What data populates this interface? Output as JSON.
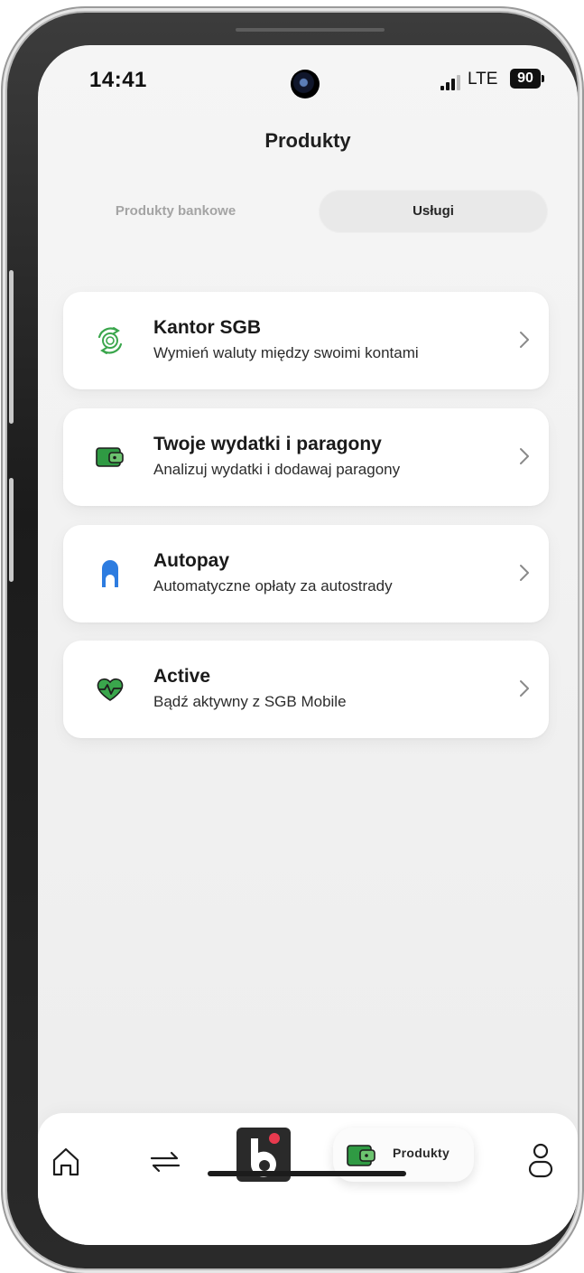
{
  "status_bar": {
    "time": "14:41",
    "network": "LTE",
    "battery": "90"
  },
  "header": {
    "title": "Produkty"
  },
  "tabs": [
    {
      "label": "Produkty bankowe",
      "active": false
    },
    {
      "label": "Usługi",
      "active": true
    }
  ],
  "services": [
    {
      "title": "Kantor SGB",
      "subtitle": "Wymień waluty między swoimi kontami",
      "icon": "currency-exchange-icon"
    },
    {
      "title": "Twoje wydatki i paragony",
      "subtitle": "Analizuj wydatki i dodawaj paragony",
      "icon": "wallet-icon"
    },
    {
      "title": "Autopay",
      "subtitle": "Automatyczne opłaty za autostrady",
      "icon": "autopay-icon"
    },
    {
      "title": "Active",
      "subtitle": "Bądź aktywny z SGB Mobile",
      "icon": "heart-pulse-icon"
    }
  ],
  "bottom_nav": {
    "items": [
      {
        "name": "home",
        "icon": "home-icon"
      },
      {
        "name": "transfers",
        "icon": "transfer-arrows-icon"
      },
      {
        "name": "brand",
        "icon": "app-logo-icon"
      },
      {
        "name": "products",
        "label": "Produkty",
        "icon": "wallet-icon",
        "active": true
      },
      {
        "name": "profile",
        "icon": "profile-icon"
      }
    ]
  },
  "colors": {
    "accent_green": "#3aa64c",
    "autopay_blue": "#2d7ce0",
    "logo_red": "#e83a4e"
  }
}
